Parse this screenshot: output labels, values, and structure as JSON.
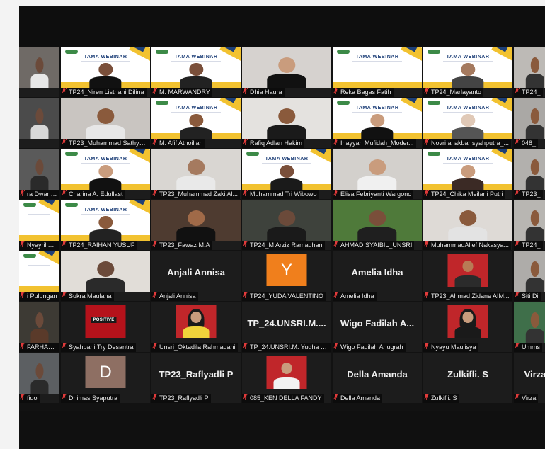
{
  "colors": {
    "muted_mic": "#e23b3b",
    "slide_blue": "#1d3f78",
    "slide_yellow": "#f2c230"
  },
  "tiles": [
    {
      "id": "r1c0",
      "label": "",
      "kind": "cam",
      "bg": "#6f6a66",
      "skin": "#6b4a3a",
      "shirt": "#e7e7e7"
    },
    {
      "id": "r1c1",
      "label": "TP24_Niren Listriani Dilina",
      "kind": "slide",
      "slide_title": "TAMA WEBINAR",
      "person": true,
      "skin": "#7a4f3a",
      "shirt": "#111"
    },
    {
      "id": "r1c2",
      "label": "M. MARWANDRY",
      "kind": "slide",
      "slide_title": "TAMA WEBINAR",
      "person": true,
      "skin": "#7a4f3a",
      "shirt": "#222"
    },
    {
      "id": "r1c3",
      "label": "Dhia Haura",
      "kind": "cam",
      "bg": "#d6d2cf",
      "skin": "#c99c7d",
      "shirt": "#111"
    },
    {
      "id": "r1c4",
      "label": "Reka Bagas Fatih",
      "kind": "slide",
      "slide_title": "TAMA WEBINAR",
      "person": false
    },
    {
      "id": "r1c5",
      "label": "TP24_Marlayanto",
      "kind": "slide",
      "slide_title": "TAMA WEBINAR",
      "person": true,
      "skin": "#a57a5f",
      "shirt": "#444"
    },
    {
      "id": "r1c6",
      "label": "TP24_",
      "kind": "cam",
      "bg": "#bdbab6",
      "skin": "#8a5a3c",
      "shirt": "#333"
    },
    {
      "id": "r2c0",
      "label": "",
      "kind": "cam",
      "bg": "#4b4b4b",
      "skin": "#6b4a3a",
      "shirt": "#d8d8d8"
    },
    {
      "id": "r2c1",
      "label": "TP23_Muhammad Sathya...",
      "kind": "cam",
      "bg": "#c9c5c1",
      "skin": "#8a5a3c",
      "shirt": "#e7e7e7"
    },
    {
      "id": "r2c2",
      "label": "M. Afif Athoillah",
      "kind": "slide",
      "slide_title": "TAMA WEBINAR",
      "person": true,
      "skin": "#8a5a3c",
      "shirt": "#222"
    },
    {
      "id": "r2c3",
      "label": "Rafiq Adlan Hakim",
      "kind": "cam",
      "bg": "#e4e2df",
      "skin": "#8a5a3c",
      "shirt": "#1a1a1a"
    },
    {
      "id": "r2c4",
      "label": "Inayyah Mufidah_Moder...",
      "kind": "slide",
      "slide_title": "TAMA WEBINAR",
      "person": true,
      "skin": "#c99c7d",
      "shirt": "#111"
    },
    {
      "id": "r2c5",
      "label": "Novri al akbar syahputra_...",
      "kind": "slide",
      "slide_title": "TAMA WEBINAR",
      "person": true,
      "skin": "#e0c9b7",
      "shirt": "#555"
    },
    {
      "id": "r2c6",
      "label": "048_",
      "kind": "cam",
      "bg": "#aaa8a5",
      "skin": "#8a5a3c",
      "shirt": "#333"
    },
    {
      "id": "r3c0",
      "label": "ra Dwansyah...",
      "kind": "cam",
      "bg": "#5a5a5a",
      "skin": "#6b4a3a",
      "shirt": "#2a2a2a"
    },
    {
      "id": "r3c1",
      "label": "Charina A. Edullast",
      "kind": "slide",
      "slide_title": "TAMA WEBINAR",
      "person": true,
      "skin": "#c99c7d",
      "shirt": "#111"
    },
    {
      "id": "r3c2",
      "label": "TP23_Muhammad Zaki Al...",
      "kind": "cam",
      "bg": "#d9d6d2",
      "skin": "#a57a5f",
      "shirt": "#e9e9e9"
    },
    {
      "id": "r3c3",
      "label": "Muhammad Tri Wibowo",
      "kind": "slide",
      "slide_title": "TAMA WEBINAR",
      "person": true,
      "skin": "#7a4f3a",
      "shirt": "#1a1a1a"
    },
    {
      "id": "r3c4",
      "label": "Elisa Febriyanti Wargono",
      "kind": "cam",
      "bg": "#d3d0cc",
      "skin": "#c99c7d",
      "shirt": "#f0f0f0"
    },
    {
      "id": "r3c5",
      "label": "TP24_Chika Meilani Putri",
      "kind": "slide",
      "slide_title": "TAMA WEBINAR",
      "person": true,
      "skin": "#c99c7d",
      "shirt": "#3b2a25"
    },
    {
      "id": "r3c6",
      "label": "TP23_",
      "kind": "cam",
      "bg": "#b2b0ad",
      "skin": "#8a5a3c",
      "shirt": "#333"
    },
    {
      "id": "r4c0",
      "label": "Nyayrilla_Unsri",
      "kind": "slide",
      "slide_title": "",
      "person": false
    },
    {
      "id": "r4c1",
      "label": "TP24_RAIHAN YUSUF",
      "kind": "slide",
      "slide_title": "TAMA WEBINAR",
      "person": true,
      "skin": "#8a5a3c",
      "shirt": "#222"
    },
    {
      "id": "r4c2",
      "label": "TP23_Fawaz M.A",
      "kind": "cam",
      "bg": "#4e3b30",
      "skin": "#a06a48",
      "shirt": "#111"
    },
    {
      "id": "r4c3",
      "label": "TP24_M Arziz Ramadhan",
      "kind": "cam",
      "bg": "#3e423c",
      "skin": "#6b4a3a",
      "shirt": "#1a1a1a"
    },
    {
      "id": "r4c4",
      "label": "AHMAD SYAIBIL_UNSRI",
      "kind": "cam",
      "bg": "#4f7a3a",
      "skin": "#7a4f3a",
      "shirt": "#1f1f1f"
    },
    {
      "id": "r4c5",
      "label": "MuhammadAlief Nakasya...",
      "kind": "cam",
      "bg": "#dedad6",
      "skin": "#8a5a3c",
      "shirt": "#e3e3e3"
    },
    {
      "id": "r4c6",
      "label": "TP24_",
      "kind": "cam",
      "bg": "#b8b6b2",
      "skin": "#8a5a3c",
      "shirt": "#333"
    },
    {
      "id": "r5c0",
      "label": "i Pulungan",
      "kind": "slide",
      "slide_title": "",
      "person": false
    },
    {
      "id": "r5c1",
      "label": "Sukra Maulana",
      "kind": "cam",
      "bg": "#e1ddd8",
      "skin": "#6b4a3a",
      "shirt": "#2a2a2a"
    },
    {
      "id": "r5c2",
      "label": "Anjali Annisa",
      "kind": "name",
      "big": "Anjali Annisa"
    },
    {
      "id": "r5c3",
      "label": "TP24_YUDA VALENTINO",
      "kind": "avatar",
      "letter": "Y",
      "avatar_bg": "#f07f1c"
    },
    {
      "id": "r5c4",
      "label": "Amelia Idha",
      "kind": "name",
      "big": "Amelia Idha"
    },
    {
      "id": "r5c5",
      "label": "TP23_Ahmad Zidane AIM...",
      "kind": "photo",
      "skin": "#b87a55",
      "shirt": "#2b2b2b"
    },
    {
      "id": "r5c6",
      "label": "Siti Di",
      "kind": "cam",
      "bg": "#aeaca9",
      "skin": "#8a5a3c",
      "shirt": "#333"
    },
    {
      "id": "r6c0",
      "label": "FARHAN CAK...",
      "kind": "cam",
      "bg": "#3d3a34",
      "skin": "#6b4a3a",
      "shirt": "#5a3a2a"
    },
    {
      "id": "r6c1",
      "label": "Syahbani Try Desantra",
      "kind": "positive",
      "badge": "POSITIVE"
    },
    {
      "id": "r6c2",
      "label": "Unsri_Oktadila Rahmadani",
      "kind": "photo",
      "skin": "#c99c7d",
      "shirt": "#f0d33b",
      "hijab": "#1a1a1a"
    },
    {
      "id": "r6c3",
      "label": "TP_24.UNSRI.M. Yudha W...",
      "kind": "name",
      "big": "TP_24.UNSRI.M...."
    },
    {
      "id": "r6c4",
      "label": "Wigo Fadilah Anugrah",
      "kind": "name",
      "big": "Wigo Fadilah A..."
    },
    {
      "id": "r6c5",
      "label": "Nyayu Maulisya",
      "kind": "photo",
      "skin": "#c99c7d",
      "shirt": "#1a1a1a",
      "hijab": "#1a1a1a"
    },
    {
      "id": "r6c6",
      "label": "Umms",
      "kind": "cam",
      "bg": "#3f6f4a",
      "skin": "#8a5a3c",
      "shirt": "#333"
    },
    {
      "id": "r7c0",
      "label": "fiqo",
      "kind": "cam",
      "bg": "#5c5f62",
      "skin": "#6b4a3a",
      "shirt": "#2a2a2a"
    },
    {
      "id": "r7c1",
      "label": "Dhimas Syaputra",
      "kind": "avatar",
      "letter": "D",
      "avatar_bg": "#8e6f63"
    },
    {
      "id": "r7c2",
      "label": "TP23_Raflyadli P",
      "kind": "name",
      "big": "TP23_Raflyadli P"
    },
    {
      "id": "r7c3",
      "label": "085_KEN DELLA FANDY",
      "kind": "photo",
      "skin": "#c99c7d",
      "shirt": "#f2f2f2"
    },
    {
      "id": "r7c4",
      "label": "Della Amanda",
      "kind": "name",
      "big": "Della Amanda"
    },
    {
      "id": "r7c5",
      "label": "Zulkifli. S",
      "kind": "name",
      "big": "Zulkifli. S"
    },
    {
      "id": "r7c6",
      "label": "Virza",
      "kind": "name",
      "big": "Virza"
    }
  ]
}
